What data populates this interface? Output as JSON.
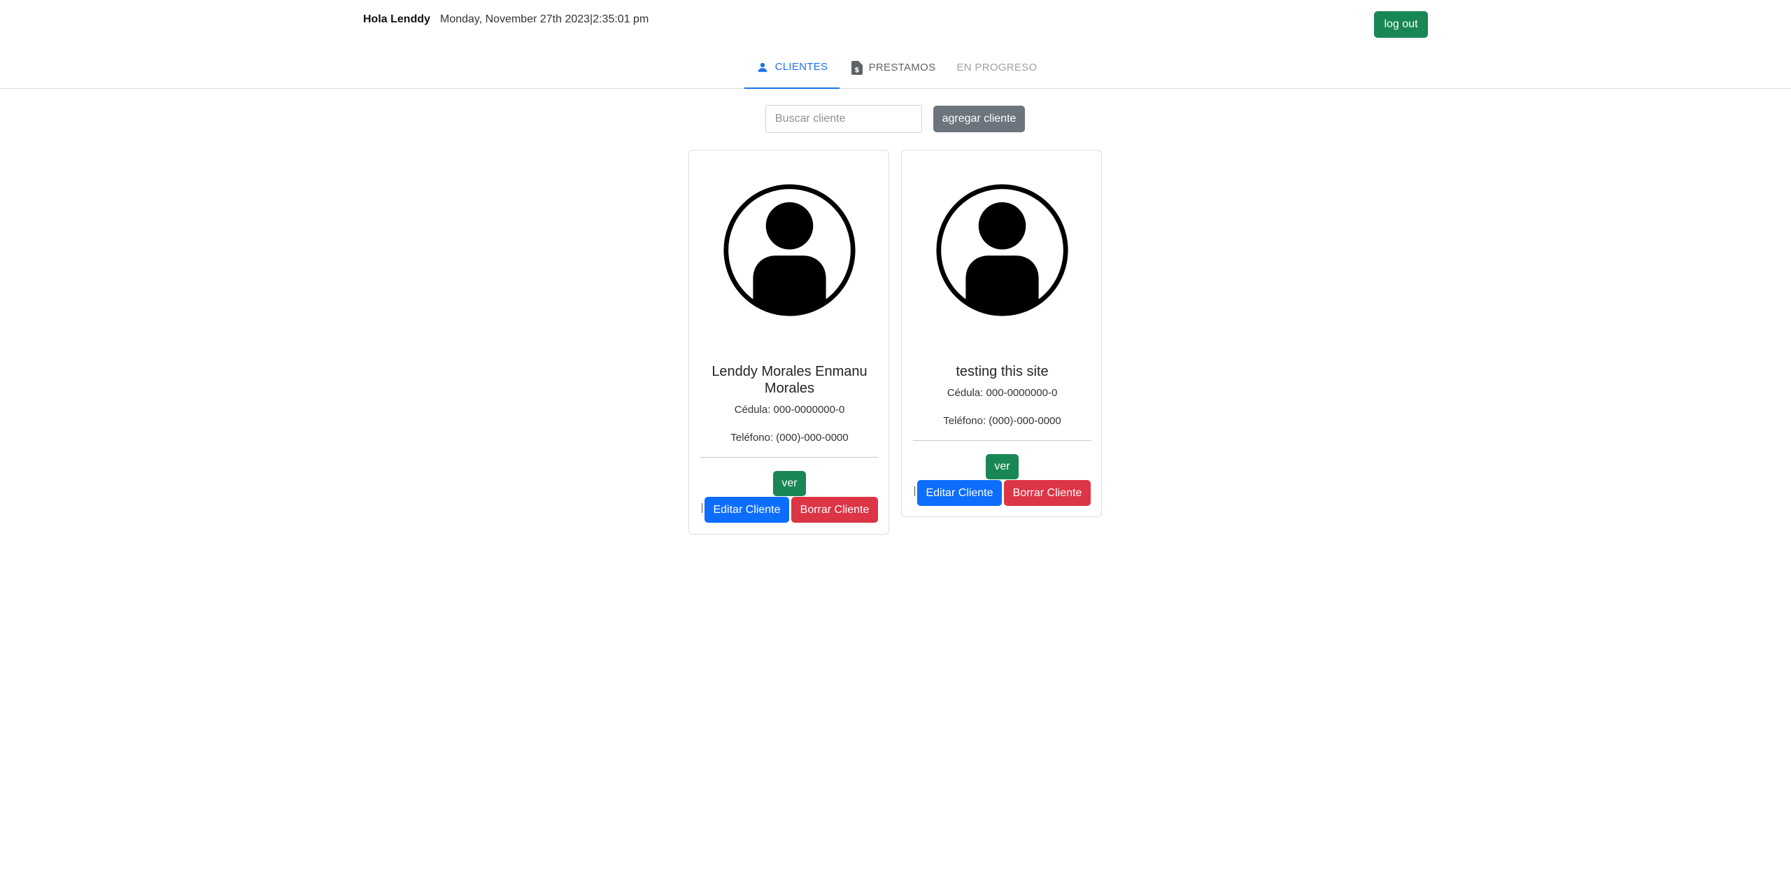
{
  "header": {
    "greeting": "Hola Lenddy",
    "datetime": "Monday, November 27th 2023|2:35:01 pm",
    "logout_label": "log out"
  },
  "tabs": [
    {
      "label": "CLIENTES",
      "icon": "person-icon",
      "state": "active"
    },
    {
      "label": "PRESTAMOS",
      "icon": "document-dollar-icon",
      "state": "normal"
    },
    {
      "label": "EN PROGRESO",
      "icon": "",
      "state": "disabled"
    }
  ],
  "search": {
    "placeholder": "Buscar cliente",
    "value": "",
    "add_label": "agregar cliente"
  },
  "clients": [
    {
      "name": "Lenddy Morales Enmanu Morales",
      "cedula": "Cédula: 000-0000000-0",
      "telefono": "Teléfono: (000)-000-0000",
      "ver_label": "ver",
      "edit_label": "Editar Cliente",
      "delete_label": "Borrar Cliente"
    },
    {
      "name": "testing this site",
      "cedula": "Cédula: 000-0000000-0",
      "telefono": "Teléfono: (000)-000-0000",
      "ver_label": "ver",
      "edit_label": "Editar Cliente",
      "delete_label": "Borrar Cliente"
    }
  ],
  "colors": {
    "success": "#198754",
    "primary": "#0d6efd",
    "danger": "#dc3545",
    "secondary": "#6c757d",
    "tab_active": "#1a73e8"
  }
}
